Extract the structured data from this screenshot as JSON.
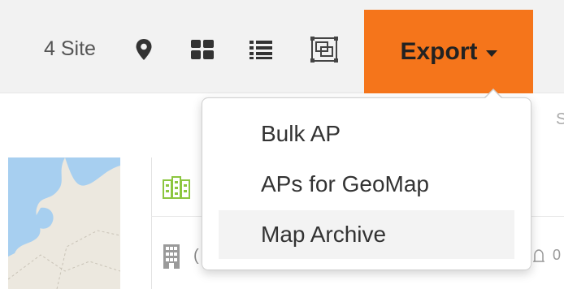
{
  "toolbar": {
    "site_count": "4 Site",
    "icons": [
      "map-pin-icon",
      "grid-view-icon",
      "list-view-icon",
      "floorplan-icon"
    ],
    "export_label": "Export",
    "export_color": "#f5751b"
  },
  "export_menu": {
    "items": [
      {
        "label": "Bulk AP"
      },
      {
        "label": "APs for GeoMap"
      },
      {
        "label": "Map Archive",
        "highlighted": true
      }
    ]
  },
  "background": {
    "row_fragment": "(",
    "bell_fragment": "0",
    "header_fragment": "S"
  },
  "colors": {
    "accent": "#f5751b",
    "building_icon_green": "#8cc63f",
    "map_water": "#a7cff0"
  }
}
